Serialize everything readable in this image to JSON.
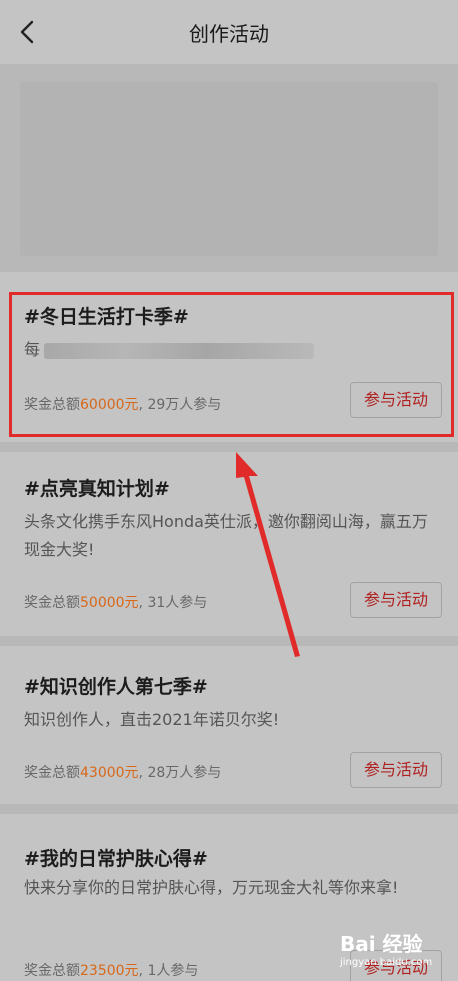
{
  "header": {
    "title": "创作活动"
  },
  "cards": [
    {
      "title": "#冬日生活打卡季#",
      "desc": "每",
      "meta_prefix": "奖金总额",
      "amount": "60000元",
      "meta_suffix": ", 29万人参与",
      "button": "参与活动"
    },
    {
      "title": "#点亮真知计划#",
      "desc": "头条文化携手东风Honda英仕派，邀你翻阅山海，赢五万现金大奖!",
      "meta_prefix": "奖金总额",
      "amount": "50000元",
      "meta_suffix": ", 31人参与",
      "button": "参与活动"
    },
    {
      "title": "#知识创作人第七季#",
      "desc": "知识创作人，直击2021年诺贝尔奖!",
      "meta_prefix": "奖金总额",
      "amount": "43000元",
      "meta_suffix": ", 28万人参与",
      "button": "参与活动"
    },
    {
      "title": "#我的日常护肤心得#",
      "desc": "快来分享你的日常护肤心得，万元现金大礼等你来拿!",
      "meta_prefix": "奖金总额",
      "amount": "23500元",
      "meta_suffix": ", 1人参与",
      "button": "参与活动"
    }
  ],
  "watermark": {
    "logo": "Bai 经验",
    "url": "jingyan.baidu.com"
  },
  "colors": {
    "amount": "#d8681a",
    "button_text": "#b02020",
    "highlight": "#e12a2a"
  }
}
